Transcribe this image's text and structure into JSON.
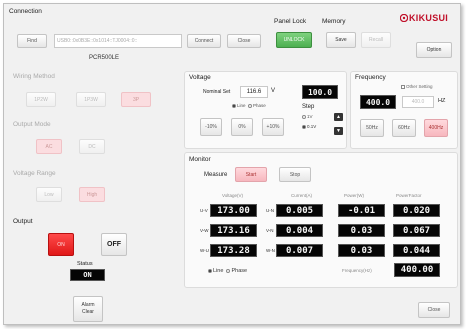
{
  "connection": {
    "title": "Connection",
    "find_label": "Find",
    "address_value": "USB0::0x0B3E::0x1014::TJ0004::0::",
    "connect_label": "Connect",
    "close_label": "Close",
    "model": "PCR500LE"
  },
  "panel_lock": {
    "title": "Panel Lock",
    "unlock_label": "UNLOCK"
  },
  "memory": {
    "title": "Memory",
    "save_label": "Save",
    "recall_label": "Recall"
  },
  "brand": {
    "name": "KIKUSUI",
    "option_label": "Option",
    "color": "#c0102a"
  },
  "wiring_method": {
    "title": "Wiring Method",
    "options": [
      "1P2W",
      "1P3W",
      "3P"
    ],
    "selected": "3P"
  },
  "output_mode": {
    "title": "Output Mode",
    "options": [
      "AC",
      "DC"
    ],
    "selected": "AC"
  },
  "voltage_range": {
    "title": "Voltage Range",
    "options": [
      "Low",
      "High"
    ],
    "selected": "High"
  },
  "output": {
    "title": "Output",
    "on_label": "ON",
    "off_label": "OFF",
    "status_label": "Status",
    "status_value": "ON"
  },
  "alarm_clear": {
    "line1": "Alarm",
    "line2": "Clear"
  },
  "voltage": {
    "title": "Voltage",
    "nominal_label": "Nominal Set",
    "nominal_value": "116.6",
    "unit": "V",
    "display_value": "100.0",
    "line_label": "Line",
    "phase_label": "Phase",
    "step_label": "Step",
    "step_options": [
      "1V",
      "0.1V"
    ],
    "step_selected": "0.1V",
    "up_icon": "▲",
    "down_icon": "▼",
    "presets": [
      "-10%",
      "0%",
      "+10%"
    ]
  },
  "frequency": {
    "title": "Frequency",
    "other_setting_label": "Other Setting",
    "display_value": "400.0",
    "input_value": "400.0",
    "unit": "HZ",
    "presets": [
      "50Hz",
      "60Hz",
      "400Hz"
    ],
    "selected": "400Hz"
  },
  "monitor": {
    "title": "Monitor",
    "measure_label": "Measure",
    "start_label": "Start",
    "stop_label": "Stop",
    "headers": [
      "Voltage(V)",
      "Current(A)",
      "Power(W)",
      "PowerFactor"
    ],
    "rows": [
      {
        "phase_v": "U-V",
        "voltage": "173.00",
        "phase_i": "U-N",
        "current": "0.005",
        "power": "-0.01",
        "pf": "0.020"
      },
      {
        "phase_v": "V-W",
        "voltage": "173.16",
        "phase_i": "V-N",
        "current": "0.004",
        "power": "0.03",
        "pf": "0.067"
      },
      {
        "phase_v": "W-U",
        "voltage": "173.28",
        "phase_i": "W-N",
        "current": "0.007",
        "power": "0.03",
        "pf": "0.044"
      }
    ],
    "line_label": "Line",
    "phase_label": "Phase",
    "frequency_label": "Frequency(Hz)",
    "frequency_value": "400.00"
  },
  "footer": {
    "close_label": "Close"
  }
}
